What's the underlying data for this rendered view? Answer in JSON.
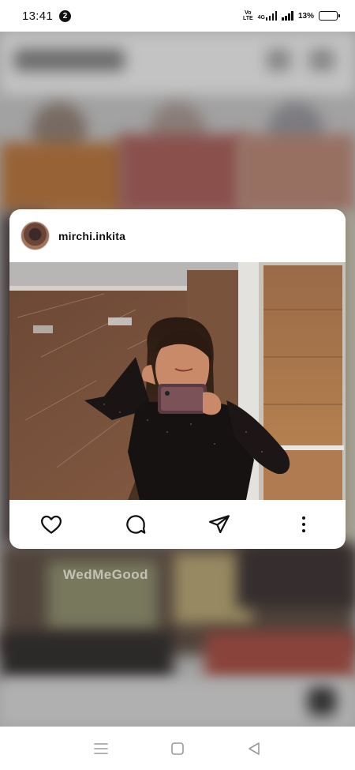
{
  "status_bar": {
    "time": "13:41",
    "notification_count": "2",
    "volte_label": "Vo\nLTE",
    "network_label": "4G",
    "battery_percent": "13%",
    "battery_level": 0.13
  },
  "background": {
    "watermark": "WedMeGood"
  },
  "post": {
    "username": "mirchi.inkita",
    "actions": [
      "like-icon",
      "comment-icon",
      "share-icon",
      "more-icon"
    ]
  },
  "nav_bar": {
    "buttons": [
      "menu-icon",
      "home-icon",
      "back-icon"
    ]
  },
  "colors": {
    "card_background": "#ffffff",
    "icon_color": "#111111",
    "nav_icon_color": "#9a9a9a"
  }
}
